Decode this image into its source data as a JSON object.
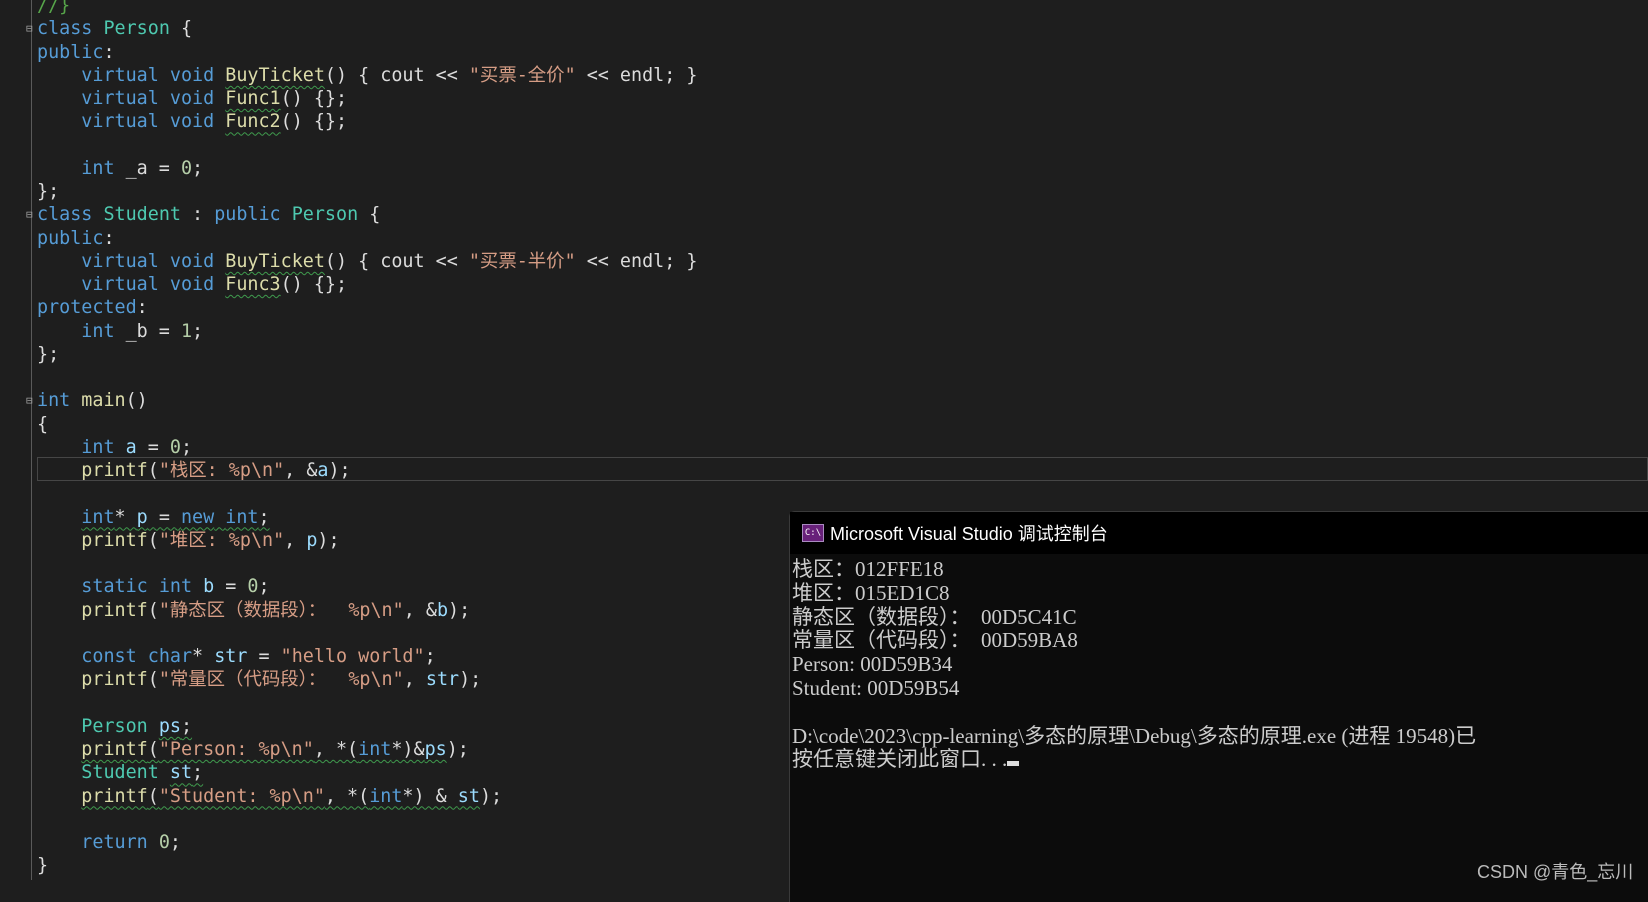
{
  "colors": {
    "background": "#1e1e1e",
    "keyword": "#569cd6",
    "type": "#4ec9b0",
    "function": "#dcdcaa",
    "string": "#d69d85",
    "number": "#b5cea8",
    "console_background": "#0c0c0c"
  },
  "editor": {
    "code_lines": [
      {
        "tokens": [
          [
            "//}",
            "c"
          ]
        ]
      },
      {
        "fold": true,
        "tokens": [
          [
            "class",
            "k"
          ],
          [
            " ",
            "p"
          ],
          [
            "Person",
            "t"
          ],
          [
            " {",
            "p"
          ]
        ]
      },
      {
        "tokens": [
          [
            "public",
            "k"
          ],
          [
            ":",
            "p"
          ]
        ]
      },
      {
        "tokens": [
          [
            "    ",
            "p"
          ],
          [
            "virtual",
            "k"
          ],
          [
            " ",
            "p"
          ],
          [
            "void",
            "k"
          ],
          [
            " ",
            "p"
          ],
          [
            "BuyTicket",
            "f",
            "sq"
          ],
          [
            "() { cout << ",
            "p"
          ],
          [
            "\"买票-全价\"",
            "s"
          ],
          [
            " << endl; }",
            "p"
          ]
        ]
      },
      {
        "tokens": [
          [
            "    ",
            "p"
          ],
          [
            "virtual",
            "k"
          ],
          [
            " ",
            "p"
          ],
          [
            "void",
            "k"
          ],
          [
            " ",
            "p"
          ],
          [
            "Func1",
            "f",
            "sq"
          ],
          [
            "() {};",
            "p"
          ]
        ]
      },
      {
        "tokens": [
          [
            "    ",
            "p"
          ],
          [
            "virtual",
            "k"
          ],
          [
            " ",
            "p"
          ],
          [
            "void",
            "k"
          ],
          [
            " ",
            "p"
          ],
          [
            "Func2",
            "f",
            "sq"
          ],
          [
            "() {};",
            "p"
          ]
        ]
      },
      {
        "tokens": []
      },
      {
        "tokens": [
          [
            "    ",
            "p"
          ],
          [
            "int",
            "k"
          ],
          [
            " _a = ",
            "p"
          ],
          [
            "0",
            "n"
          ],
          [
            ";",
            "p"
          ]
        ]
      },
      {
        "tokens": [
          [
            "};",
            "p"
          ]
        ]
      },
      {
        "fold": true,
        "tokens": [
          [
            "class",
            "k"
          ],
          [
            " ",
            "p"
          ],
          [
            "Student",
            "t"
          ],
          [
            " : ",
            "p"
          ],
          [
            "public",
            "k"
          ],
          [
            " ",
            "p"
          ],
          [
            "Person",
            "t"
          ],
          [
            " {",
            "p"
          ]
        ]
      },
      {
        "tokens": [
          [
            "public",
            "k"
          ],
          [
            ":",
            "p"
          ]
        ]
      },
      {
        "tokens": [
          [
            "    ",
            "p"
          ],
          [
            "virtual",
            "k"
          ],
          [
            " ",
            "p"
          ],
          [
            "void",
            "k"
          ],
          [
            " ",
            "p"
          ],
          [
            "BuyTicket",
            "f",
            "sq"
          ],
          [
            "() { cout << ",
            "p"
          ],
          [
            "\"买票-半价\"",
            "s"
          ],
          [
            " << endl; }",
            "p"
          ]
        ]
      },
      {
        "tokens": [
          [
            "    ",
            "p"
          ],
          [
            "virtual",
            "k"
          ],
          [
            " ",
            "p"
          ],
          [
            "void",
            "k"
          ],
          [
            " ",
            "p"
          ],
          [
            "Func3",
            "f",
            "sq"
          ],
          [
            "() {};",
            "p"
          ]
        ]
      },
      {
        "tokens": [
          [
            "protected",
            "k"
          ],
          [
            ":",
            "p"
          ]
        ]
      },
      {
        "tokens": [
          [
            "    ",
            "p"
          ],
          [
            "int",
            "k"
          ],
          [
            " _b = ",
            "p"
          ],
          [
            "1",
            "n"
          ],
          [
            ";",
            "p"
          ]
        ]
      },
      {
        "tokens": [
          [
            "};",
            "p"
          ]
        ]
      },
      {
        "tokens": []
      },
      {
        "fold": true,
        "tokens": [
          [
            "int",
            "k"
          ],
          [
            " ",
            "p"
          ],
          [
            "main",
            "f"
          ],
          [
            "()",
            "p"
          ]
        ]
      },
      {
        "tokens": [
          [
            "{",
            "p"
          ]
        ]
      },
      {
        "tokens": [
          [
            "    ",
            "p"
          ],
          [
            "int",
            "k"
          ],
          [
            " ",
            "p"
          ],
          [
            "a",
            "v"
          ],
          [
            " = ",
            "p"
          ],
          [
            "0",
            "n"
          ],
          [
            ";",
            "p"
          ]
        ]
      },
      {
        "tokens": [
          [
            "    ",
            "p"
          ],
          [
            "printf",
            "f"
          ],
          [
            "(",
            "p"
          ],
          [
            "\"栈区: %p\\n\"",
            "s"
          ],
          [
            ", &",
            "p"
          ],
          [
            "a",
            "v"
          ],
          [
            ");",
            "p"
          ]
        ]
      },
      {
        "tokens": []
      },
      {
        "tokens": [
          [
            "    ",
            "p"
          ],
          [
            "int",
            "k",
            "sq"
          ],
          [
            "* ",
            "p",
            "sq"
          ],
          [
            "p",
            "v",
            "sq"
          ],
          [
            " = ",
            "p",
            "sq"
          ],
          [
            "new",
            "k",
            "sq"
          ],
          [
            " ",
            "p",
            "sq"
          ],
          [
            "int",
            "k",
            "sq"
          ],
          [
            ";",
            "p",
            "sq"
          ]
        ]
      },
      {
        "tokens": [
          [
            "    ",
            "p"
          ],
          [
            "printf",
            "f"
          ],
          [
            "(",
            "p"
          ],
          [
            "\"堆区: %p\\n\"",
            "s"
          ],
          [
            ", ",
            "p"
          ],
          [
            "p",
            "v"
          ],
          [
            ");",
            "p"
          ]
        ]
      },
      {
        "tokens": []
      },
      {
        "tokens": [
          [
            "    ",
            "p"
          ],
          [
            "static",
            "k"
          ],
          [
            " ",
            "p"
          ],
          [
            "int",
            "k"
          ],
          [
            " ",
            "p"
          ],
          [
            "b",
            "v"
          ],
          [
            " = ",
            "p"
          ],
          [
            "0",
            "n"
          ],
          [
            ";",
            "p"
          ]
        ]
      },
      {
        "tokens": [
          [
            "    ",
            "p"
          ],
          [
            "printf",
            "f"
          ],
          [
            "(",
            "p"
          ],
          [
            "\"静态区（数据段）：  %p\\n\"",
            "s"
          ],
          [
            ", &",
            "p"
          ],
          [
            "b",
            "v"
          ],
          [
            ");",
            "p"
          ]
        ]
      },
      {
        "tokens": []
      },
      {
        "tokens": [
          [
            "    ",
            "p"
          ],
          [
            "const",
            "k"
          ],
          [
            " ",
            "p"
          ],
          [
            "char",
            "k"
          ],
          [
            "* ",
            "p"
          ],
          [
            "str",
            "v"
          ],
          [
            " = ",
            "p"
          ],
          [
            "\"hello world\"",
            "s"
          ],
          [
            ";",
            "p"
          ]
        ]
      },
      {
        "tokens": [
          [
            "    ",
            "p"
          ],
          [
            "printf",
            "f"
          ],
          [
            "(",
            "p"
          ],
          [
            "\"常量区（代码段）：  %p\\n\"",
            "s"
          ],
          [
            ", ",
            "p"
          ],
          [
            "str",
            "v"
          ],
          [
            ");",
            "p"
          ]
        ]
      },
      {
        "tokens": []
      },
      {
        "tokens": [
          [
            "    ",
            "p"
          ],
          [
            "Person",
            "t"
          ],
          [
            " ",
            "p"
          ],
          [
            "ps",
            "v",
            "sq"
          ],
          [
            ";",
            "p",
            "sq"
          ]
        ]
      },
      {
        "tokens": [
          [
            "    ",
            "p"
          ],
          [
            "printf",
            "f",
            "sq"
          ],
          [
            "(",
            "p",
            "sq"
          ],
          [
            "\"Person: %p\\n\"",
            "s",
            "sq"
          ],
          [
            ", *(",
            "p",
            "sq"
          ],
          [
            "int",
            "k",
            "sq"
          ],
          [
            "*)&",
            "p",
            "sq"
          ],
          [
            "ps",
            "v",
            "sq"
          ],
          [
            ");",
            "p"
          ]
        ]
      },
      {
        "tokens": [
          [
            "    ",
            "p"
          ],
          [
            "Student",
            "t"
          ],
          [
            " ",
            "p"
          ],
          [
            "st",
            "v",
            "sq"
          ],
          [
            ";",
            "p",
            "sq"
          ]
        ]
      },
      {
        "tokens": [
          [
            "    ",
            "p"
          ],
          [
            "printf",
            "f",
            "sq"
          ],
          [
            "(",
            "p",
            "sq"
          ],
          [
            "\"Student: %p\\n\"",
            "s",
            "sq"
          ],
          [
            ", *(",
            "p",
            "sq"
          ],
          [
            "int",
            "k",
            "sq"
          ],
          [
            "*) & ",
            "p",
            "sq"
          ],
          [
            "st",
            "v",
            "sq"
          ],
          [
            ");",
            "p"
          ]
        ]
      },
      {
        "tokens": []
      },
      {
        "tokens": [
          [
            "    ",
            "p"
          ],
          [
            "return",
            "k"
          ],
          [
            " ",
            "p"
          ],
          [
            "0",
            "n"
          ],
          [
            ";",
            "p"
          ]
        ]
      },
      {
        "tokens": [
          [
            "}",
            "p"
          ]
        ]
      }
    ]
  },
  "console": {
    "title": "Microsoft Visual Studio 调试控制台",
    "icon": "console-app-icon",
    "lines": [
      "栈区：012FFE18",
      "堆区：015ED1C8",
      "静态区（数据段）：  00D5C41C",
      "常量区（代码段）：  00D59BA8",
      "Person: 00D59B34",
      "Student: 00D59B54",
      "",
      "D:\\code\\2023\\cpp-learning\\多态的原理\\Debug\\多态的原理.exe (进程 19548)已",
      "按任意键关闭此窗口. . ."
    ]
  },
  "watermark": "CSDN @青色_忘川"
}
